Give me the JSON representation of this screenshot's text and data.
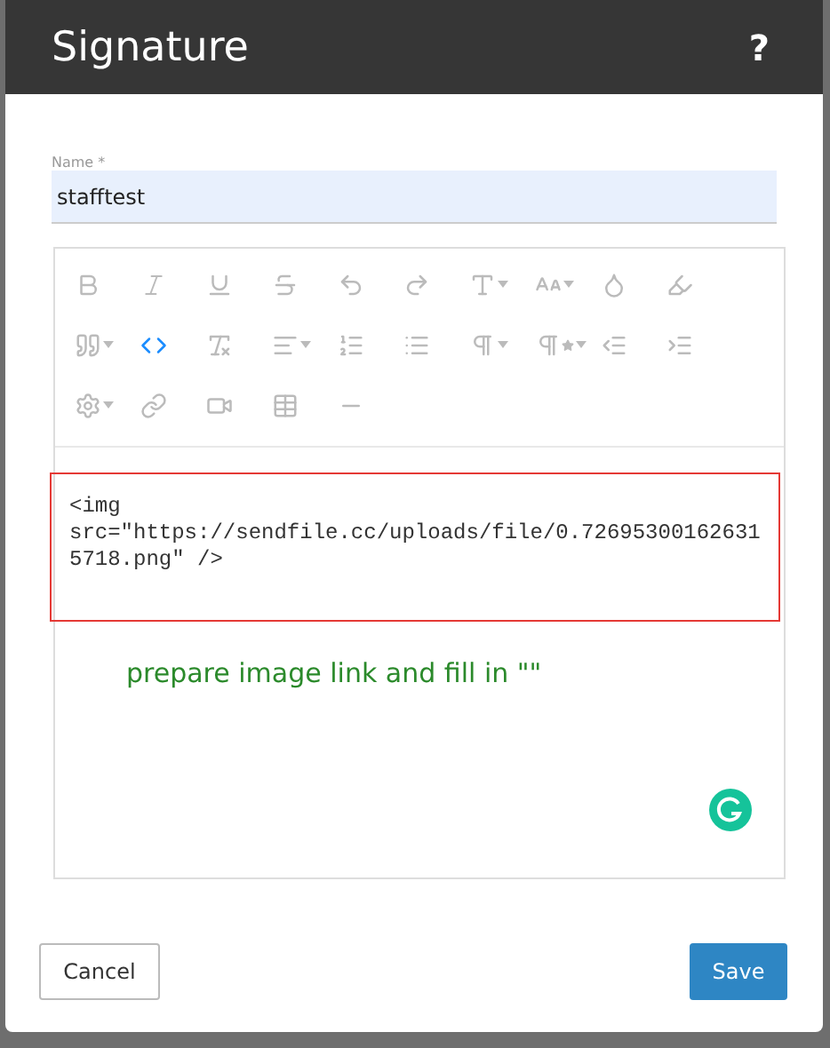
{
  "dialog": {
    "title": "Signature",
    "help": "?"
  },
  "name_field": {
    "label": "Name *",
    "value": "stafftest"
  },
  "toolbar": [
    {
      "kind": "bold",
      "dropdown": false,
      "active": false
    },
    {
      "kind": "italic",
      "dropdown": false,
      "active": false
    },
    {
      "kind": "underline",
      "dropdown": false,
      "active": false
    },
    {
      "kind": "strike",
      "dropdown": false,
      "active": false
    },
    {
      "kind": "undo",
      "dropdown": false,
      "active": false
    },
    {
      "kind": "redo",
      "dropdown": false,
      "active": false
    },
    {
      "kind": "font",
      "dropdown": true,
      "active": false
    },
    {
      "kind": "size",
      "dropdown": true,
      "active": false
    },
    {
      "kind": "color",
      "dropdown": false,
      "active": false
    },
    {
      "kind": "highlight",
      "dropdown": false,
      "active": false
    },
    {
      "kind": "quote",
      "dropdown": true,
      "active": false
    },
    {
      "kind": "code",
      "dropdown": false,
      "active": true
    },
    {
      "kind": "clear",
      "dropdown": false,
      "active": false
    },
    {
      "kind": "align",
      "dropdown": true,
      "active": false
    },
    {
      "kind": "ordered",
      "dropdown": false,
      "active": false
    },
    {
      "kind": "bullets",
      "dropdown": false,
      "active": false
    },
    {
      "kind": "paragraph",
      "dropdown": true,
      "active": false
    },
    {
      "kind": "paragraph-style",
      "dropdown": true,
      "active": false
    },
    {
      "kind": "outdent",
      "dropdown": false,
      "active": false
    },
    {
      "kind": "indent",
      "dropdown": false,
      "active": false
    },
    {
      "kind": "settings",
      "dropdown": true,
      "active": false
    },
    {
      "kind": "link",
      "dropdown": false,
      "active": false
    },
    {
      "kind": "video",
      "dropdown": false,
      "active": false
    },
    {
      "kind": "table",
      "dropdown": false,
      "active": false
    },
    {
      "kind": "rule",
      "dropdown": false,
      "active": false
    }
  ],
  "code": "<img src=\"https://sendfile.cc/uploads/file/0.726953001626315718.png\" />",
  "note": "prepare image link and fill in \"\"",
  "buttons": {
    "cancel": "Cancel",
    "save": "Save"
  }
}
